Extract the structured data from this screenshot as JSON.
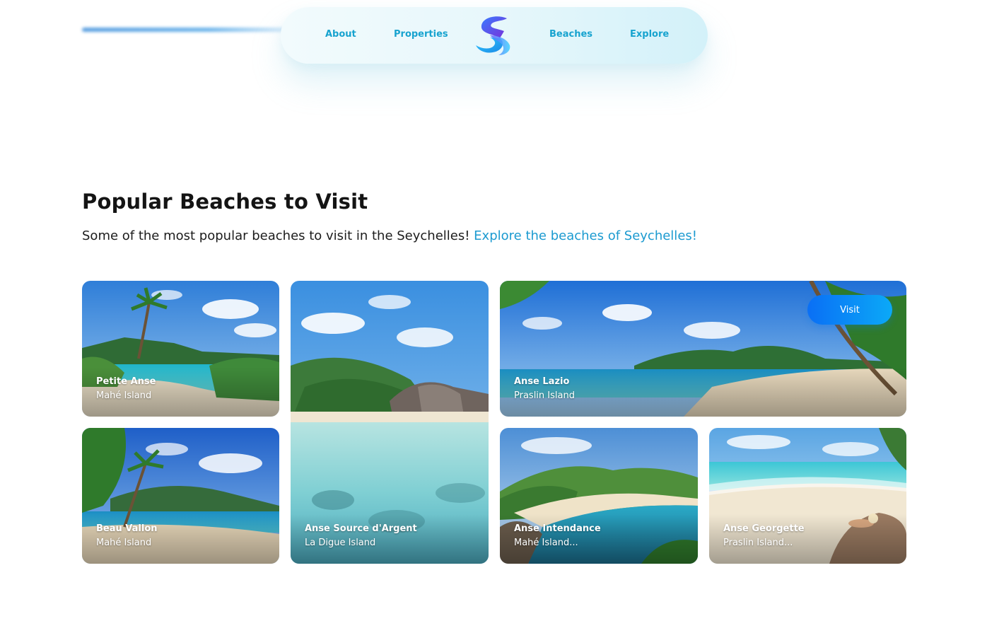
{
  "nav": {
    "about": "About",
    "properties": "Properties",
    "beaches": "Beaches",
    "explore": "Explore"
  },
  "section": {
    "title": "Popular Beaches to Visit",
    "subtitle": "Some of the most popular beaches to visit in the Seychelles!",
    "subtitle_link": "Explore the beaches of Seychelles!"
  },
  "beaches": [
    {
      "name": "Petite Anse",
      "location": "Mahé Island"
    },
    {
      "name": "Anse Source d'Argent",
      "location": "La Digue Island"
    },
    {
      "name": "Anse Lazio",
      "location": "Praslin Island",
      "button": "Visit"
    },
    {
      "name": "Beau Vallon",
      "location": "Mahé Island"
    },
    {
      "name": "Anse Intendance",
      "location": "Mahé Island..."
    },
    {
      "name": "Anse Georgette",
      "location": "Praslin Island..."
    }
  ],
  "colors": {
    "accent": "#17a3cf",
    "link": "#1b9ad0",
    "button_start": "#0a6ff5",
    "button_end": "#0ba9f7"
  }
}
